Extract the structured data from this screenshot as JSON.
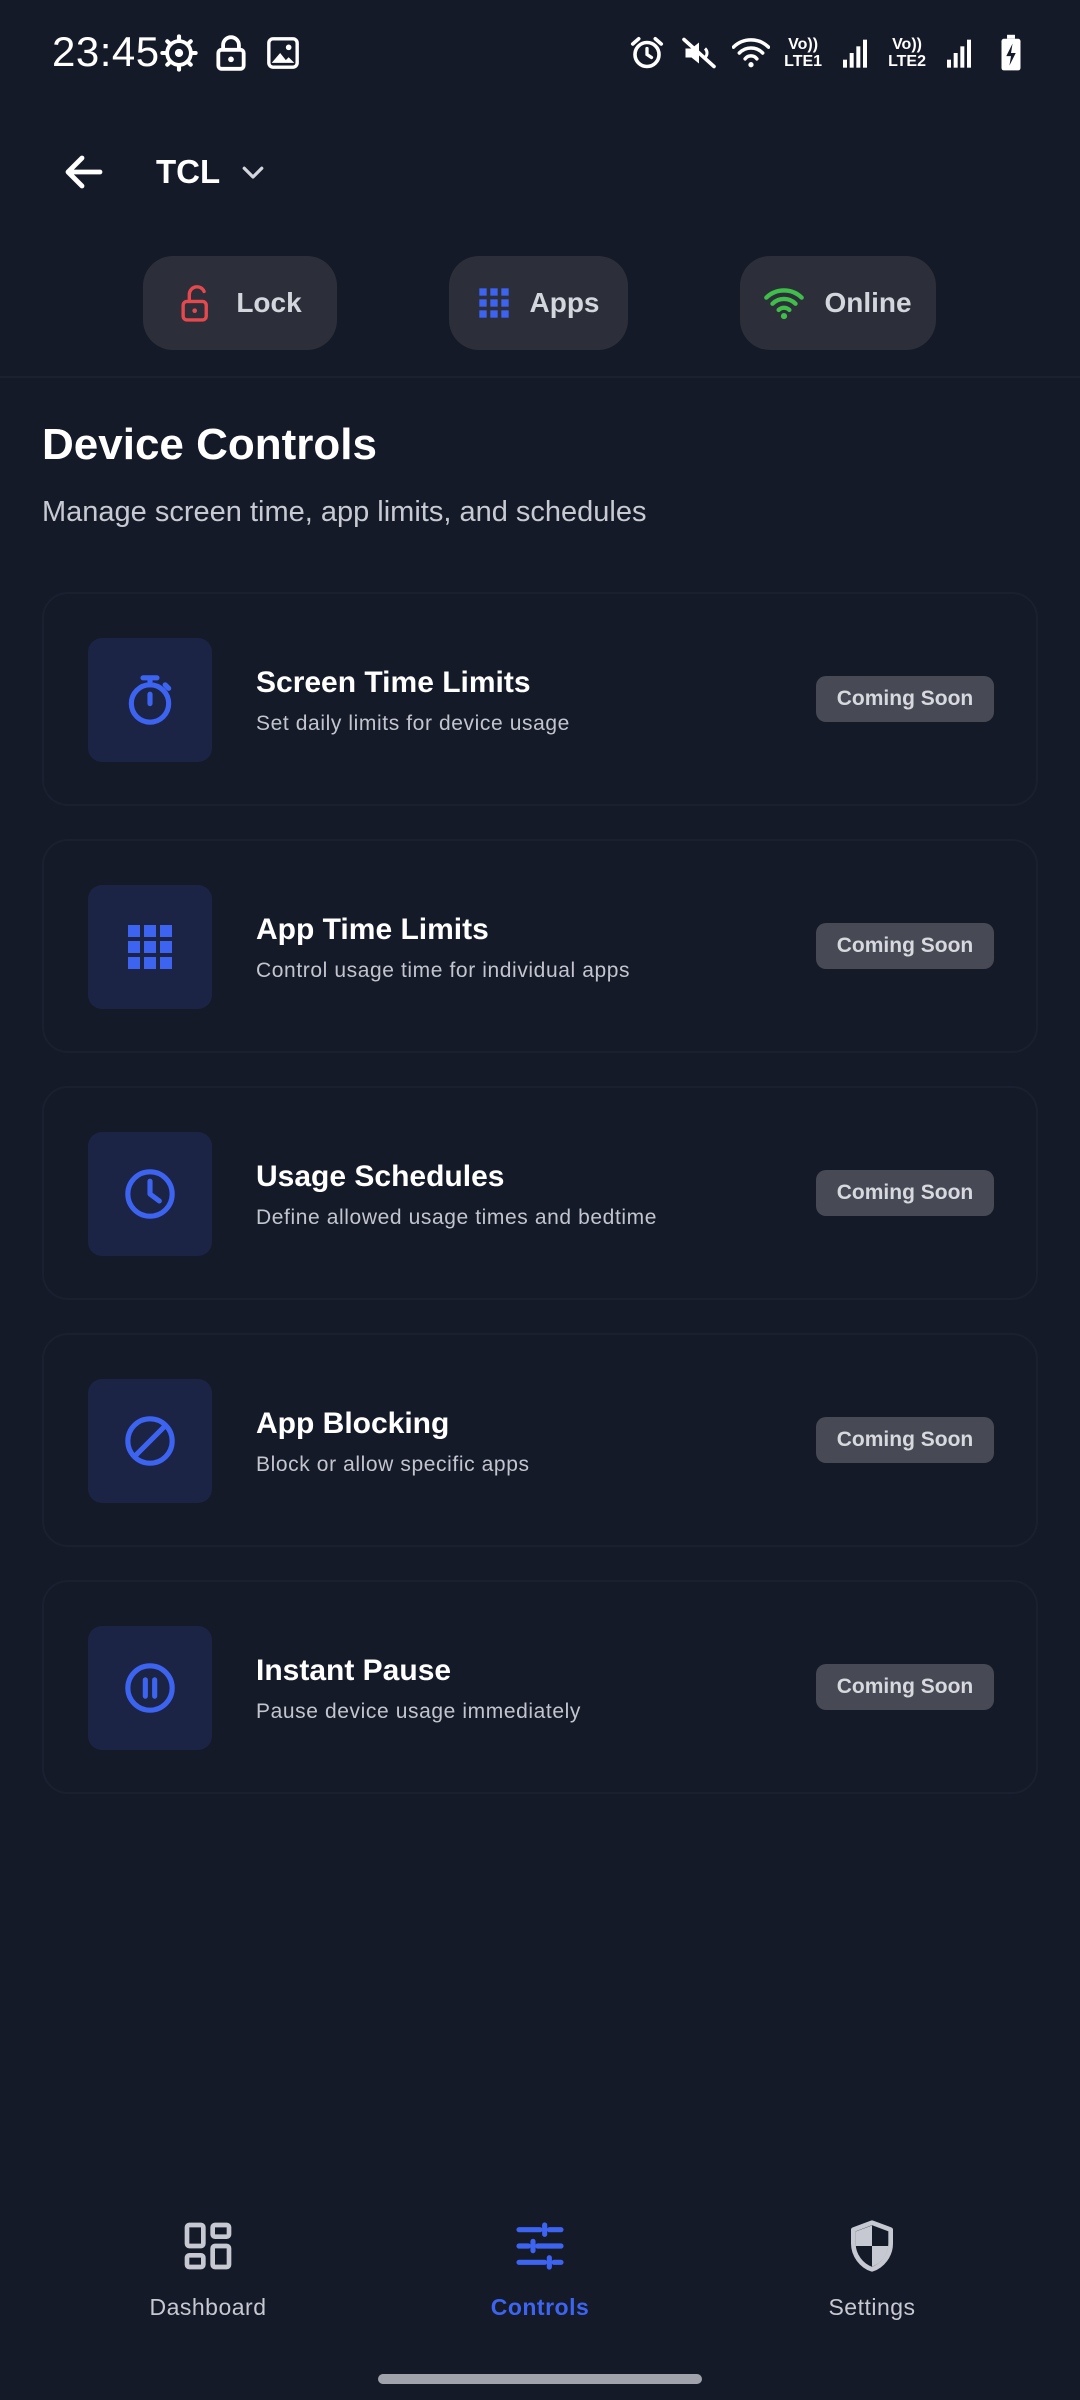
{
  "status_bar": {
    "time": "23:45",
    "left_icons": [
      "gear-icon",
      "lock-icon",
      "image-icon"
    ],
    "right_icons": [
      "alarm-icon",
      "mute-icon",
      "wifi-icon",
      "signal-icon",
      "signal-icon",
      "battery-charging-icon"
    ],
    "sim1": {
      "top": "Vo))",
      "bottom": "LTE1"
    },
    "sim2": {
      "top": "Vo))",
      "bottom": "LTE2"
    }
  },
  "header": {
    "back_icon": "arrow-left-icon",
    "device_name": "TCL",
    "dropdown_icon": "chevron-down-icon"
  },
  "chips": [
    {
      "label": "Lock",
      "icon": "unlock-icon",
      "color": "#e5484d"
    },
    {
      "label": "Apps",
      "icon": "grid-icon",
      "color": "#3d63f1"
    },
    {
      "label": "Online",
      "icon": "wifi-icon",
      "color": "#3fbe4a"
    }
  ],
  "section": {
    "title": "Device Controls",
    "subtitle": "Manage screen time, app limits, and schedules"
  },
  "controls": [
    {
      "title": "Screen Time Limits",
      "description": "Set daily limits for device usage",
      "status": "Coming Soon",
      "icon": "stopwatch-icon"
    },
    {
      "title": "App Time Limits",
      "description": "Control usage time for individual apps",
      "status": "Coming Soon",
      "icon": "grid-icon"
    },
    {
      "title": "Usage Schedules",
      "description": "Define allowed usage times and bedtime",
      "status": "Coming Soon",
      "icon": "clock-icon"
    },
    {
      "title": "App Blocking",
      "description": "Block or allow specific apps",
      "status": "Coming Soon",
      "icon": "block-icon"
    },
    {
      "title": "Instant Pause",
      "description": "Pause device usage immediately",
      "status": "Coming Soon",
      "icon": "pause-icon"
    }
  ],
  "bottom_nav": [
    {
      "label": "Dashboard",
      "icon": "dashboard-icon",
      "active": false
    },
    {
      "label": "Controls",
      "icon": "sliders-icon",
      "active": true
    },
    {
      "label": "Settings",
      "icon": "shield-icon",
      "active": false
    }
  ],
  "colors": {
    "background": "#151a28",
    "accent": "#3d63f1",
    "icon_box": "#1b2444",
    "badge": "#474a55",
    "chip": "#2c2f3a"
  }
}
